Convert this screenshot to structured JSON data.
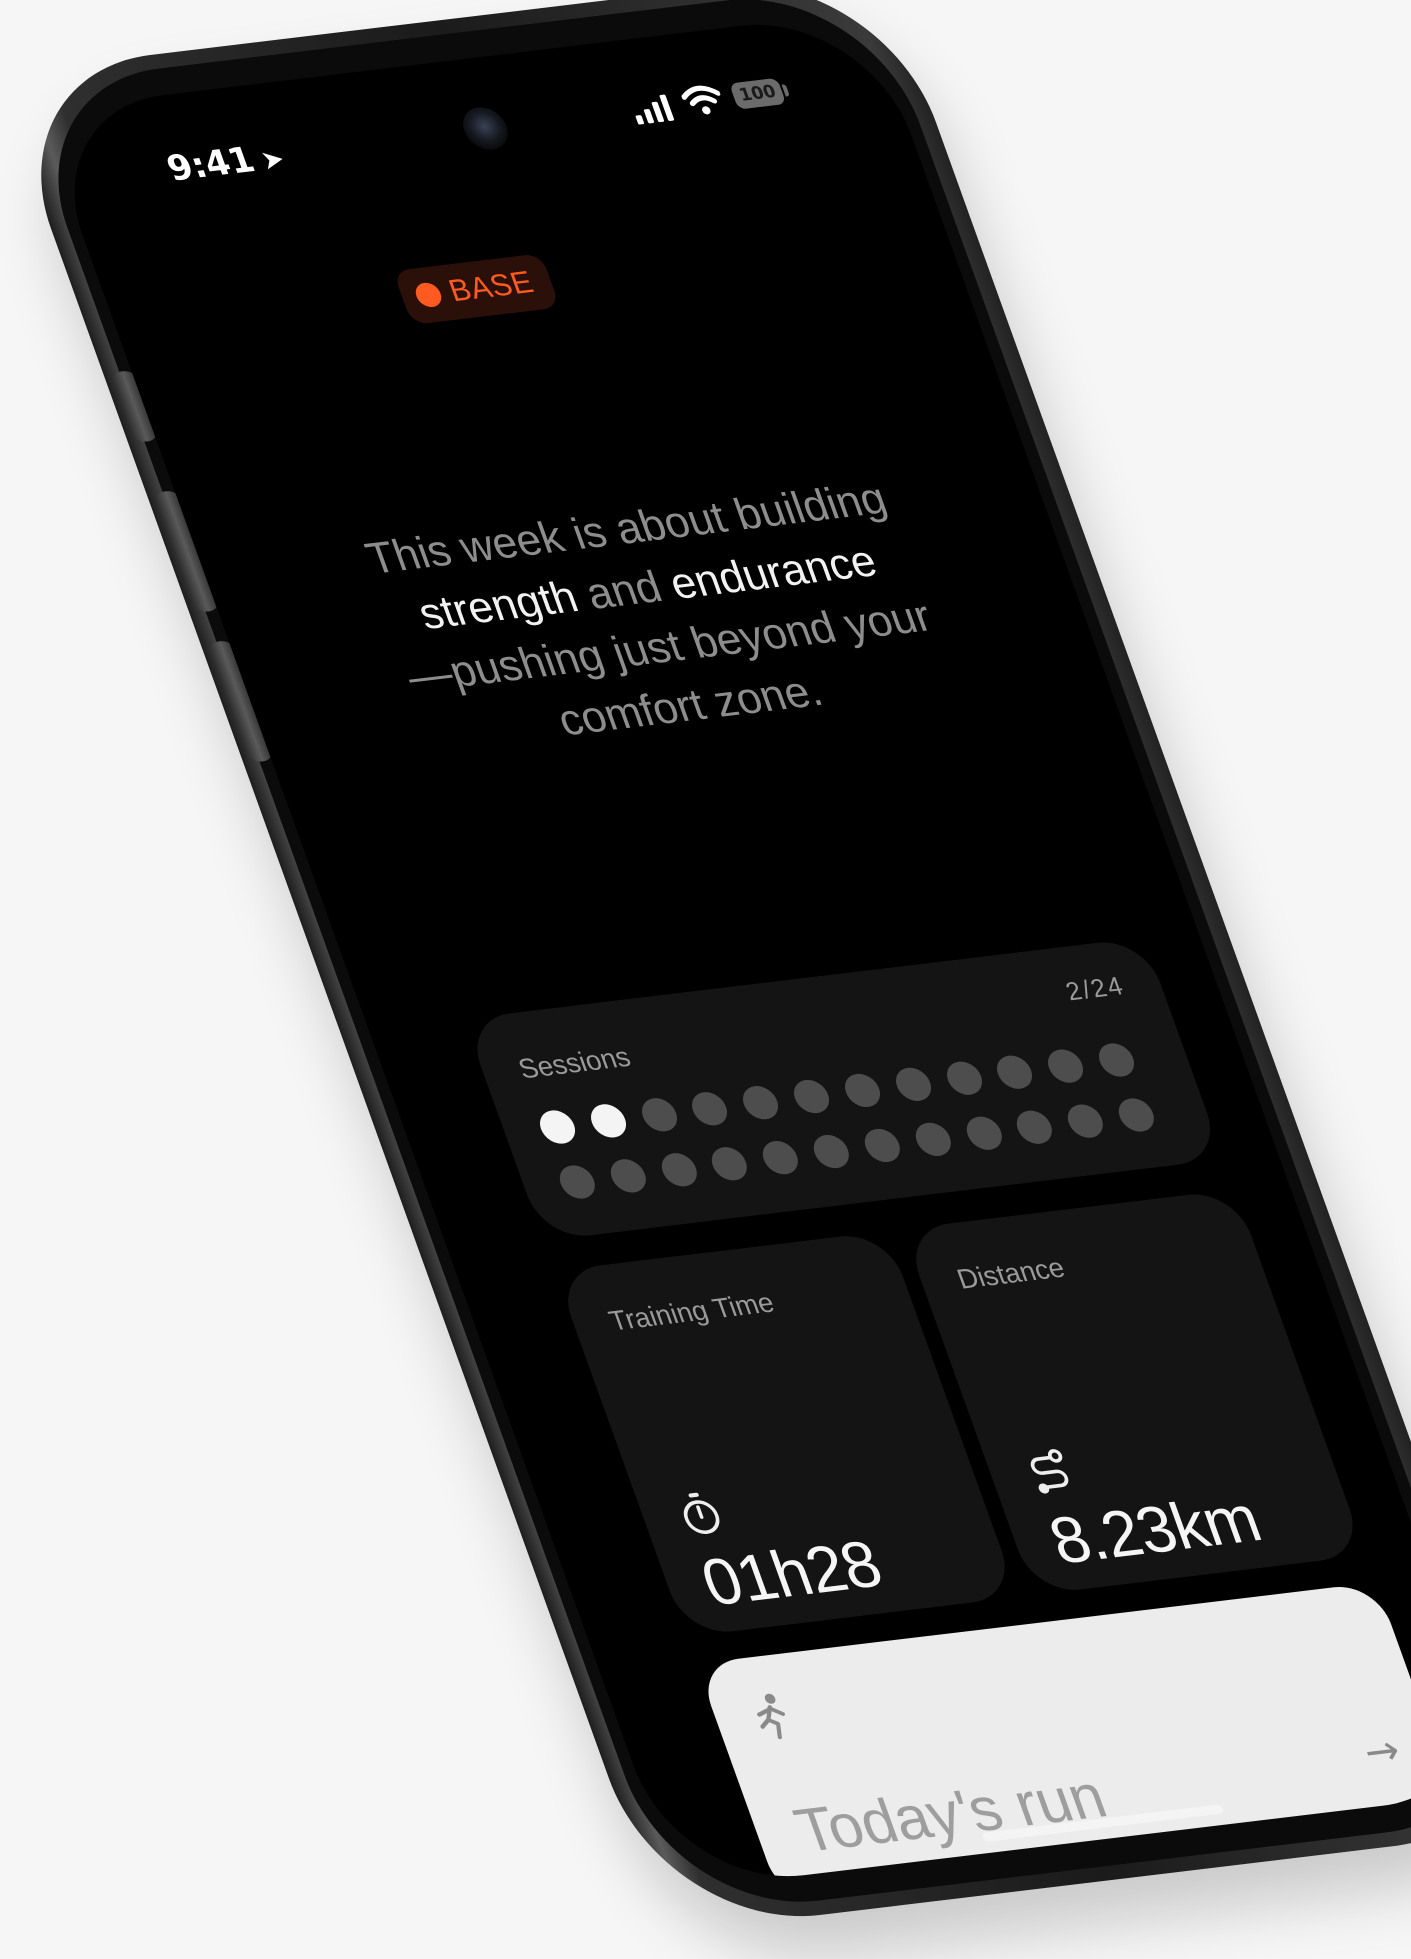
{
  "status_bar": {
    "time": "9:41",
    "location_icon": "location-arrow-icon",
    "signal_icon": "cellular-signal-icon",
    "wifi_icon": "wifi-icon",
    "battery_level": "100"
  },
  "phase": {
    "label": "BASE",
    "color": "#ff5a1f"
  },
  "tagline": {
    "part1": "This week is about building",
    "highlight1": "strength",
    "part2": " and ",
    "highlight2": "endurance",
    "part3": "—pushing just beyond your comfort zone."
  },
  "sessions": {
    "label": "Sessions",
    "count": "2/24",
    "completed": 2,
    "total": 24
  },
  "training_time": {
    "label": "Training Time",
    "icon": "stopwatch-icon",
    "value": "01h28"
  },
  "distance": {
    "label": "Distance",
    "icon": "route-icon",
    "value": "8.23km"
  },
  "todays_run": {
    "icon": "runner-icon",
    "label": "Today's run",
    "arrow_icon": "arrow-right-icon"
  }
}
